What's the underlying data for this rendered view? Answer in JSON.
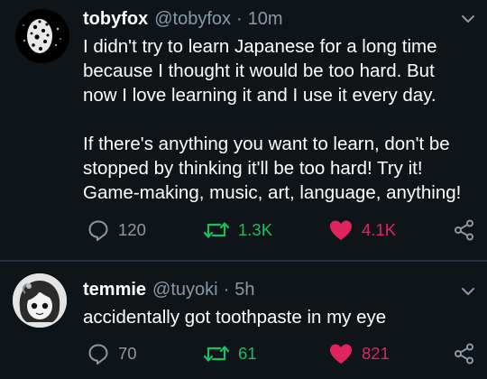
{
  "tweets": [
    {
      "display_name": "tobyfox",
      "handle": "@tobyfox",
      "separator": "·",
      "time": "10m",
      "paragraphs": [
        [
          "I didn't try to learn Japanese for a long time",
          "because I thought it would be too hard. But",
          "now I love learning it and I use it every day."
        ],
        [
          "If there's anything you want to learn, don't be",
          "stopped by thinking it'll be too hard! Try it!",
          "Game-making, music, art, language, anything!"
        ]
      ],
      "reply_count": "120",
      "retweet_count": "1.3K",
      "like_count": "4.1K",
      "liked": true
    },
    {
      "display_name": "temmie",
      "handle": "@tuyoki",
      "separator": "·",
      "time": "5h",
      "paragraphs": [
        [
          "accidentally got toothpaste in my eye"
        ]
      ],
      "reply_count": "70",
      "retweet_count": "61",
      "like_count": "821",
      "liked": true
    }
  ],
  "colors": {
    "background": "#0f1419",
    "secondary_text": "#8899a6",
    "retweet_green": "#17bf63",
    "like_red": "#e0245e",
    "divider": "#253341"
  },
  "icons": {
    "menu": "chevron-down-icon",
    "reply": "reply-icon",
    "retweet": "retweet-icon",
    "like": "heart-icon",
    "share": "share-icon"
  }
}
